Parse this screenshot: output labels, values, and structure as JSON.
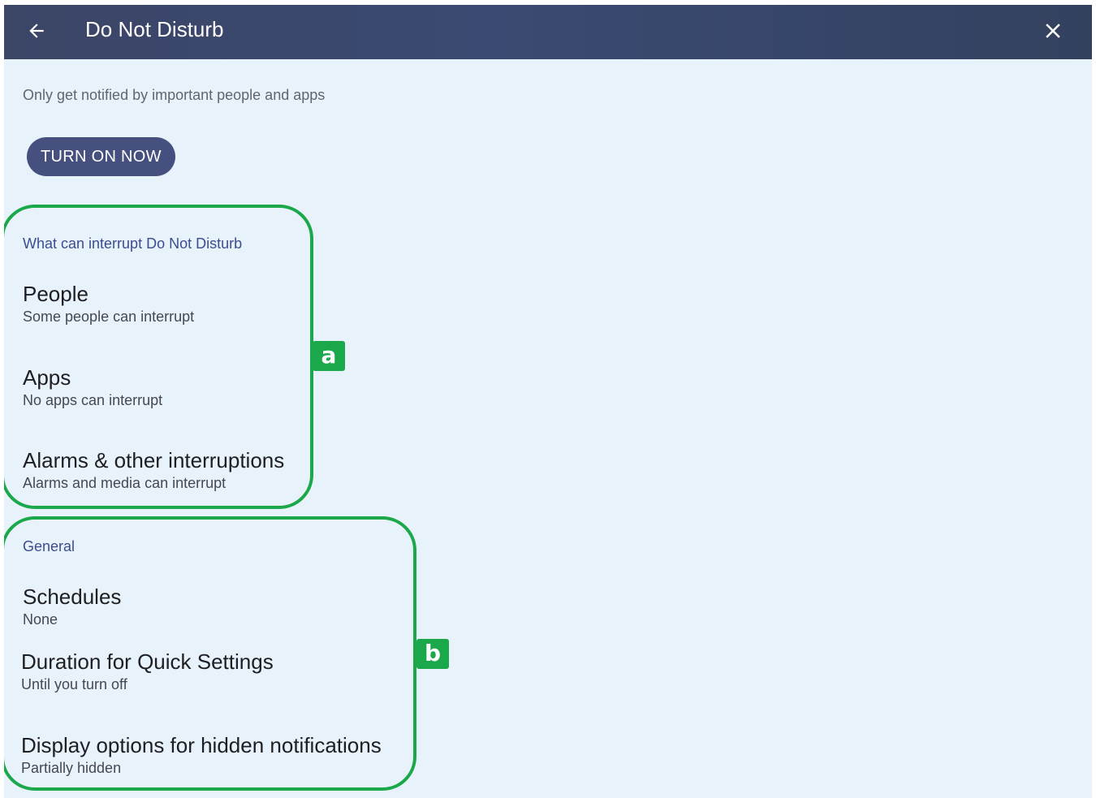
{
  "header": {
    "title": "Do Not Disturb",
    "back_icon": "back-arrow-icon",
    "close_icon": "close-icon"
  },
  "intro": {
    "subtitle": "Only get notified by important people and apps",
    "turn_on_label": "TURN ON NOW"
  },
  "sections": [
    {
      "header": "What can interrupt Do Not Disturb",
      "items": [
        {
          "title": "People",
          "subtitle": "Some people can interrupt"
        },
        {
          "title": "Apps",
          "subtitle": "No apps can interrupt"
        },
        {
          "title": "Alarms & other interruptions",
          "subtitle": "Alarms and media can interrupt"
        }
      ]
    },
    {
      "header": "General",
      "items": [
        {
          "title": "Schedules",
          "subtitle": "None"
        },
        {
          "title": "Duration for Quick Settings",
          "subtitle": "Until you turn off"
        },
        {
          "title": "Display options for hidden notifications",
          "subtitle": "Partially hidden"
        }
      ]
    }
  ],
  "callouts": {
    "a": "a",
    "b": "b"
  },
  "colors": {
    "appbar": "#3a4a72",
    "background": "#e8f2fa",
    "button": "#46507e",
    "section_header": "#3c4d91",
    "callout": "#1aa84a"
  }
}
